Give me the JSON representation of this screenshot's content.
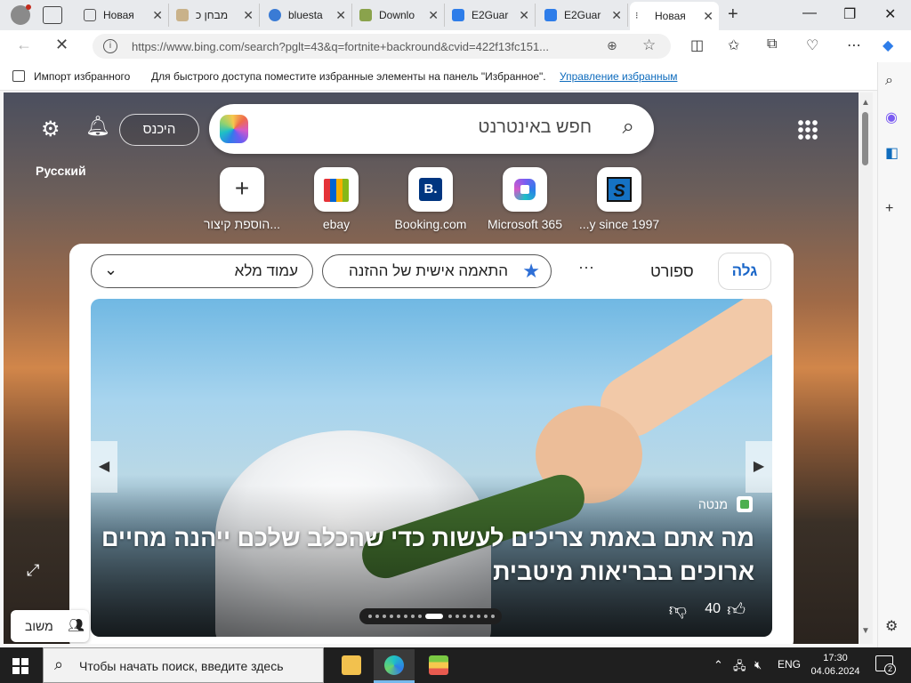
{
  "tabs": [
    {
      "title": "Новая",
      "favicon_color": "#555555"
    },
    {
      "title": "מבחן כ",
      "favicon_color": "#c9b28a"
    },
    {
      "title": "bluesta",
      "favicon_color": "#3a7bd5"
    },
    {
      "title": "Downlo",
      "favicon_color": "#8aa34c"
    },
    {
      "title": "E2Guar",
      "favicon_color": "#2e7de9"
    },
    {
      "title": "E2Guar",
      "favicon_color": "#2e7de9"
    },
    {
      "title": "Новая",
      "favicon_color": "#333333"
    }
  ],
  "address": {
    "url": "https://www.bing.com/search?pglt=43&q=fortnite+backround&cvid=422f13fc151..."
  },
  "favorites_bar": {
    "import": "Импорт избранного",
    "hint": "Для быстрого доступа поместите избранные элементы на панель \"Избранное\".",
    "manage": "Управление избранным"
  },
  "newtab": {
    "signin": "היכנס",
    "language": "Русский",
    "search_placeholder": "חפש באינטרנט",
    "quicklinks": [
      {
        "label": "הוספת קיצור...",
        "icon": "plus-icon"
      },
      {
        "label": "ebay",
        "icon": "ebay-icon"
      },
      {
        "label": "Booking.com",
        "icon": "booking-icon",
        "glyph": "B."
      },
      {
        "label": "Microsoft 365",
        "icon": "microsoft365-icon"
      },
      {
        "label": "...y since 1997",
        "icon": "s-logo-icon",
        "glyph": "S"
      }
    ],
    "feed": {
      "layout_pill": "עמוד מלא",
      "personalize_pill": "התאמה אישית של ההזנה",
      "more": "···",
      "tab_sport": "ספורט",
      "tab_discover": "גלה",
      "hero": {
        "source": "מנטה",
        "headline": "מה אתם באמת צריכים לעשות כדי שהכלב שלכם ייהנה מחיים ארוכים בבריאות מיטבית",
        "likes": "40",
        "slide_count": 16,
        "current_slide": 8
      }
    },
    "feedback": "משוב"
  },
  "taskbar": {
    "search_placeholder": "Чтобы начать поиск, введите здесь",
    "lang": "ENG",
    "time": "17:30",
    "date": "04.06.2024",
    "notifications": "2"
  }
}
